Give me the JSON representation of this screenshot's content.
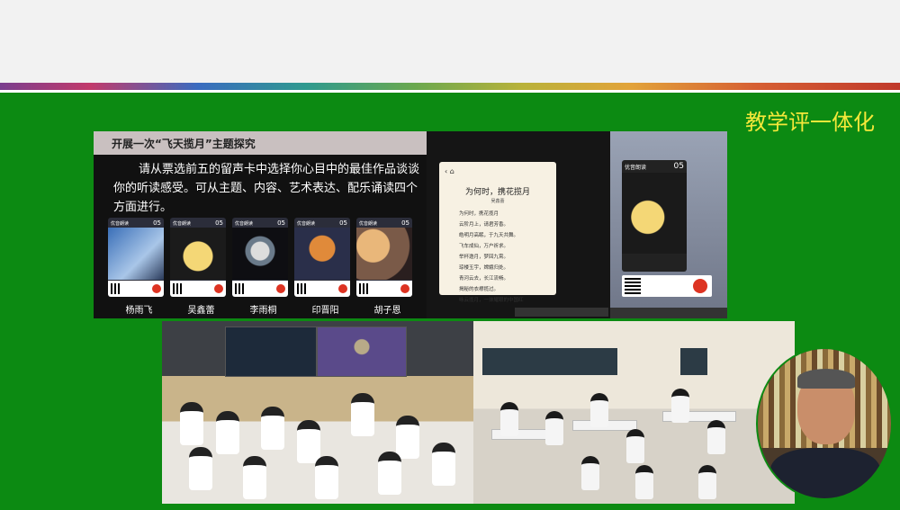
{
  "slide_title": "教学评一体化",
  "lesson_slide": {
    "header": "开展一次“飞天揽月”主题探究",
    "body": "请从票选前五的留声卡中选择你心目中的最佳作品谈谈你的听读感受。可从主题、内容、艺术表达、配乐诵读四个方面进行。",
    "card_head": "优音朗读",
    "card_num": "05",
    "students": [
      "杨雨飞",
      "吴鑫蕾",
      "李雨桐",
      "印晋阳",
      "胡子恩"
    ]
  },
  "poem": {
    "nav": "‹ ⌂",
    "title": "为何时，携花揽月",
    "author": "吴鑫蕾",
    "lines": [
      "为何时，携花揽月",
      "云阶月上，请君芳香。",
      "皓明月高眠，于九天共舞。",
      "飞车成仙，万户祈求。",
      "举杯邀月，梦回九霄。",
      "琼楼玉宇，嫦娥归处。",
      "青河云去，长江流畅。",
      "揭秘的衣襟揽过。",
      "咏云揽月，一抹耀眼的中国红"
    ]
  },
  "phone_card": {
    "head": "优音朗读",
    "num": "05"
  },
  "colors": {
    "background_green": "#0c8a12",
    "title_yellow": "#f5e83a"
  }
}
